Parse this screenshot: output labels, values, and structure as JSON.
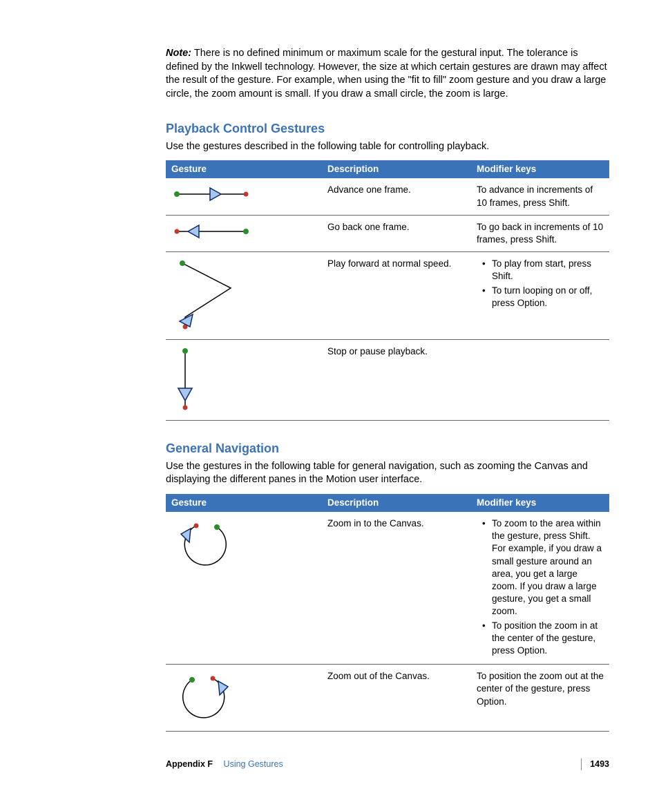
{
  "note": {
    "label": "Note:",
    "text": "There is no defined minimum or maximum scale for the gestural input. The tolerance is defined by the Inkwell technology. However, the size at which certain gestures are drawn may affect the result of the gesture. For example, when using the \"fit to fill\" zoom gesture and you draw a large circle, the zoom amount is small. If you draw a small circle, the zoom is large."
  },
  "sections": {
    "playback": {
      "title": "Playback Control Gestures",
      "intro": "Use the gestures described in the following table for controlling playback."
    },
    "nav": {
      "title": "General Navigation",
      "intro": "Use the gestures in the following table for general navigation, such as zooming the Canvas and displaying the different panes in the Motion user interface."
    }
  },
  "table_headers": {
    "gesture": "Gesture",
    "description": "Description",
    "modifier": "Modifier keys"
  },
  "playback_rows": [
    {
      "desc": "Advance one frame.",
      "mod_text": "To advance in increments of 10 frames, press Shift."
    },
    {
      "desc": "Go back one frame.",
      "mod_text": "To go back in increments of 10 frames, press Shift."
    },
    {
      "desc": "Play forward at normal speed.",
      "mod_bullets": [
        "To play from start, press Shift.",
        "To turn looping on or off, press Option."
      ]
    },
    {
      "desc": "Stop or pause playback.",
      "mod_text": ""
    }
  ],
  "nav_rows": [
    {
      "desc": "Zoom in to the Canvas.",
      "mod_bullets": [
        "To zoom to the area within the gesture, press Shift. For example, if you draw a small gesture around an area, you get a large zoom. If you draw a large gesture, you get a small zoom.",
        "To position the zoom in at the center of the gesture, press Option."
      ]
    },
    {
      "desc": "Zoom out of the Canvas.",
      "mod_text": "To position the zoom out at the center of the gesture, press Option."
    }
  ],
  "footer": {
    "appendix": "Appendix F",
    "chapter": "Using Gestures",
    "page": "1493"
  }
}
